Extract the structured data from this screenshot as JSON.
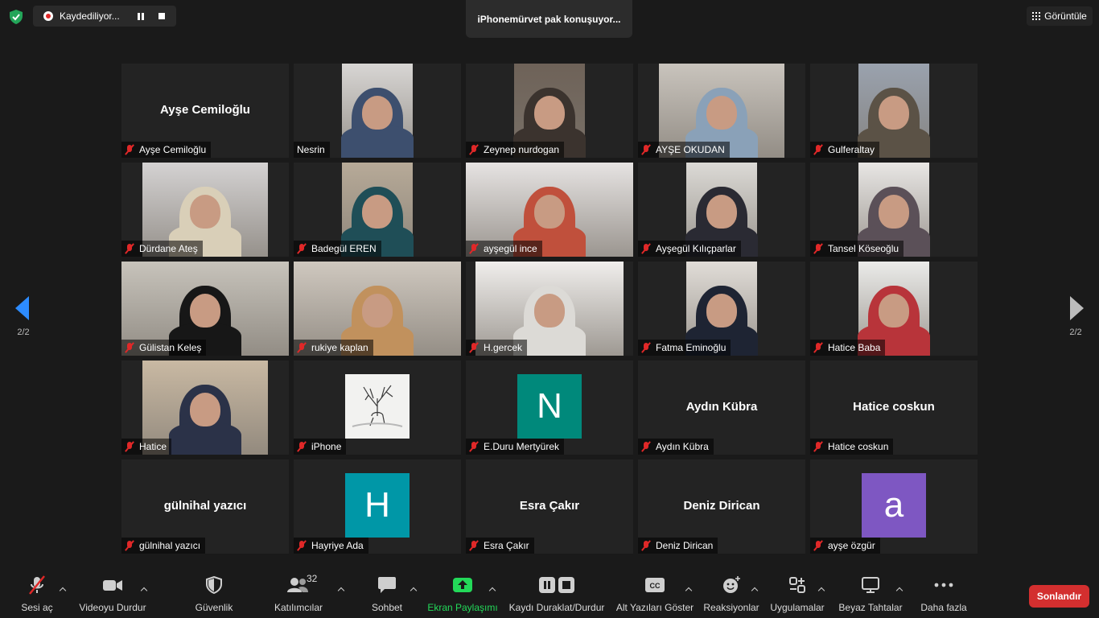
{
  "top": {
    "recording_label": "Kaydediliyor...",
    "speaker_label": "iPhonemürvet pak konuşuyor...",
    "view_label": "Görüntüle"
  },
  "nav": {
    "left_page": "2/2",
    "right_page": "2/2"
  },
  "participants": [
    {
      "name": "Ayşe Cemiloğlu",
      "big_name": "Ayşe Cemiloğlu",
      "kind": "name",
      "muted": true
    },
    {
      "name": "Nesrin",
      "kind": "video",
      "muted": false,
      "video_bg": "#d8d6d4",
      "scarf": "#3d4f6e"
    },
    {
      "name": "Zeynep nurdogan",
      "kind": "video",
      "muted": true,
      "video_bg": "#6e6258",
      "scarf": "#3b332e"
    },
    {
      "name": "AYŞE OKUDAN",
      "kind": "video",
      "muted": true,
      "video_bg": "#c9c4bd",
      "scarf": "#8aa1b8"
    },
    {
      "name": "Gulferaltay",
      "kind": "video",
      "muted": true,
      "video_bg": "#9aa2ae",
      "scarf": "#5b5246"
    },
    {
      "name": "Dürdane Ateş",
      "kind": "video",
      "muted": true,
      "video_bg": "#d4d2d2",
      "scarf": "#d9cfb8"
    },
    {
      "name": "Badegül EREN",
      "kind": "video",
      "muted": true,
      "video_bg": "#b7aa98",
      "scarf": "#1f4e57"
    },
    {
      "name": "ayşegül ince",
      "kind": "video",
      "muted": true,
      "video_bg": "#e6e3e2",
      "scarf": "#c0503c"
    },
    {
      "name": "Ayşegül Kılıçparlar",
      "kind": "video",
      "muted": true,
      "video_bg": "#dcdad6",
      "scarf": "#2a2a33"
    },
    {
      "name": "Tansel Köseoğlu",
      "kind": "video",
      "muted": true,
      "video_bg": "#e8e6e4",
      "scarf": "#5b5058"
    },
    {
      "name": "Gülistan  Keleş",
      "kind": "video",
      "muted": true,
      "video_bg": "#c7c3bb",
      "scarf": "#171717"
    },
    {
      "name": "rukiye kaplan",
      "kind": "video",
      "muted": true,
      "video_bg": "#cfc8bf",
      "scarf": "#c1915d"
    },
    {
      "name": "H.gercek",
      "kind": "video",
      "muted": true,
      "video_bg": "#f0eeec",
      "scarf": "#dcdad6"
    },
    {
      "name": "Fatma Eminoğlu",
      "kind": "video",
      "muted": true,
      "video_bg": "#e1ddd8",
      "scarf": "#1e2433"
    },
    {
      "name": "Hatice Baba",
      "kind": "video",
      "muted": true,
      "video_bg": "#ebebe9",
      "scarf": "#b8343a"
    },
    {
      "name": "Hatice",
      "kind": "video",
      "muted": true,
      "video_bg": "#c9b9a3",
      "scarf": "#2b3248"
    },
    {
      "name": "iPhone",
      "kind": "image",
      "muted": true
    },
    {
      "name": "E.Duru  Mertyürek",
      "kind": "avatar",
      "muted": true,
      "letter": "N",
      "color": "#00897b"
    },
    {
      "name": "Aydın Kübra",
      "big_name": "Aydın Kübra",
      "kind": "name",
      "muted": true
    },
    {
      "name": "Hatice coskun",
      "big_name": "Hatice coskun",
      "kind": "name",
      "muted": true
    },
    {
      "name": "gülnihal yazıcı",
      "big_name": "gülnihal yazıcı",
      "kind": "name",
      "muted": true
    },
    {
      "name": "Hayriye Ada",
      "kind": "avatar",
      "muted": true,
      "letter": "H",
      "color": "#0097a7"
    },
    {
      "name": "Esra Çakır",
      "big_name": "Esra Çakır",
      "kind": "name",
      "muted": true
    },
    {
      "name": "Deniz Dirican",
      "big_name": "Deniz Dirican",
      "kind": "name",
      "muted": true
    },
    {
      "name": "ayşe özgür",
      "kind": "avatar",
      "muted": true,
      "letter": "a",
      "color": "#7e57c2"
    }
  ],
  "toolbar": {
    "unmute": "Sesi aç",
    "stop_video": "Videoyu Durdur",
    "security": "Güvenlik",
    "participants": "Katılımcılar",
    "participants_count": "32",
    "chat": "Sohbet",
    "share_screen": "Ekran Paylaşımı",
    "pause_stop_recording": "Kaydı Duraklat/Durdur",
    "captions": "Alt Yazıları Göster",
    "captions_icon_text": "CC",
    "reactions": "Reaksiyonlar",
    "apps": "Uygulamalar",
    "whiteboards": "Beyaz Tahtalar",
    "more": "Daha fazla",
    "end": "Sonlandır"
  },
  "colors": {
    "accent_blue": "#2d8cff",
    "share_green": "#23d959",
    "end_red": "#d32f2f",
    "mute_red": "#e02828"
  }
}
